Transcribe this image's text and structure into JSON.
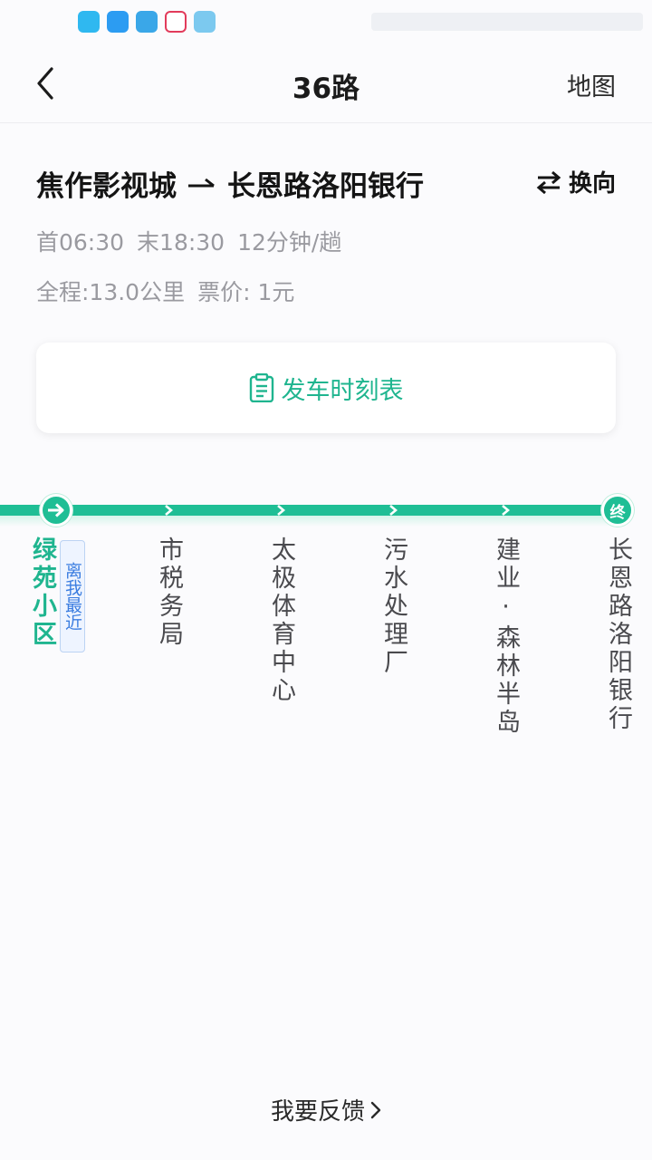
{
  "header": {
    "title": "36路",
    "map_label": "地图"
  },
  "route": {
    "origin": "焦作影视城",
    "destination": "长恩路洛阳银行",
    "switch_label": "换向",
    "first_bus": "首06:30",
    "last_bus": "末18:30",
    "interval": "12分钟/趟",
    "distance": "全程:13.0公里",
    "fare": "票价: 1元"
  },
  "timetable": {
    "label": "发车时刻表"
  },
  "line": {
    "end_marker": "终",
    "nearest_badge": "离我最近",
    "stops": [
      {
        "name": "绿苑小区",
        "current": true
      },
      {
        "name": "市税务局"
      },
      {
        "name": "太极体育中心"
      },
      {
        "name": "污水处理厂"
      },
      {
        "name": "建业·森林半岛"
      },
      {
        "name": "长恩路洛阳银行"
      }
    ]
  },
  "footer": {
    "feedback_label": "我要反馈"
  },
  "colors": {
    "accent": "#1fbe95",
    "accent_text": "#1fb58f",
    "badge_blue": "#3b7de0"
  },
  "icons": [
    "back-arrow-icon",
    "swap-arrows-icon",
    "clipboard-icon",
    "arrow-right-circle-icon",
    "chevron-right-icon"
  ]
}
